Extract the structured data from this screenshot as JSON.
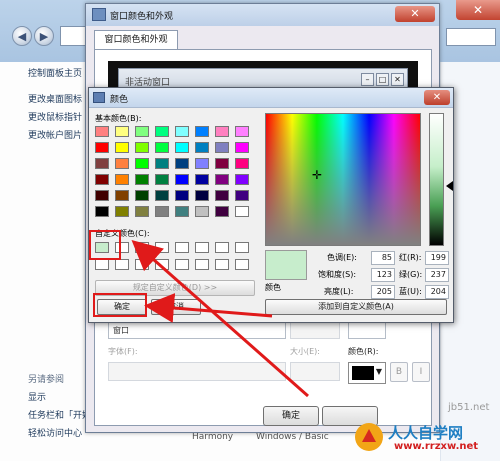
{
  "background_window": {
    "sidebar": {
      "links": [
        "控制面板主页",
        "更改桌面图标",
        "更改鼠标指针",
        "更改帐户图片"
      ],
      "see_also_title": "另请参阅",
      "see_also_links": [
        "显示",
        "任务栏和「开始」",
        "轻松访问中心"
      ]
    },
    "footer": [
      "Harmony",
      "Windows / Basic"
    ]
  },
  "window_color_dialog": {
    "title": "窗口颜色和外观",
    "tab": "窗口颜色和外观",
    "inactive_window_title": "非活动窗口",
    "item_value": "窗口",
    "font_label": "字体(F):",
    "size_label": "大小(E):",
    "color_label": "颜色(R):",
    "bold_label": "B",
    "italic_label": "I",
    "ok_button": "确定"
  },
  "color_picker": {
    "title": "颜色",
    "basic_colors_label": "基本颜色(B):",
    "basic_colors": [
      [
        "#ff8080",
        "#ffff80",
        "#80ff80",
        "#00ff80",
        "#80ffff",
        "#0080ff",
        "#ff80c0",
        "#ff80ff"
      ],
      [
        "#ff0000",
        "#ffff00",
        "#80ff00",
        "#00ff40",
        "#00ffff",
        "#0080c0",
        "#8080c0",
        "#ff00ff"
      ],
      [
        "#804040",
        "#ff8040",
        "#00ff00",
        "#008080",
        "#004080",
        "#8080ff",
        "#800040",
        "#ff0080"
      ],
      [
        "#800000",
        "#ff8000",
        "#008000",
        "#008040",
        "#0000ff",
        "#0000a0",
        "#800080",
        "#8000ff"
      ],
      [
        "#400000",
        "#804000",
        "#004000",
        "#004040",
        "#000080",
        "#000040",
        "#400040",
        "#400080"
      ],
      [
        "#000000",
        "#808000",
        "#808040",
        "#808080",
        "#408080",
        "#c0c0c0",
        "#400040",
        "#ffffff"
      ]
    ],
    "custom_colors_label": "自定义颜色(C):",
    "custom_colors": [
      "#c7edcc",
      "#ffffff",
      "#ffffff",
      "#ffffff",
      "#ffffff",
      "#ffffff",
      "#ffffff",
      "#ffffff",
      "#ffffff",
      "#ffffff",
      "#ffffff",
      "#ffffff",
      "#ffffff",
      "#ffffff",
      "#ffffff",
      "#ffffff"
    ],
    "define_custom_button": "规定自定义颜色(D) >>",
    "ok_button": "确定",
    "cancel_button": "取消",
    "color_solid_label": "颜色",
    "hue_label": "色调(E):",
    "hue_value": "85",
    "sat_label": "饱和度(S):",
    "sat_value": "123",
    "lum_label": "亮度(L):",
    "lum_value": "205",
    "red_label": "红(R):",
    "red_value": "199",
    "green_label": "绿(G):",
    "green_value": "237",
    "blue_label": "蓝(U):",
    "blue_value": "204",
    "add_custom_button": "添加到自定义颜色(A)",
    "selected_color": "#c7edcc"
  },
  "watermarks": {
    "site": "jb51.net",
    "brand": "人人自学网",
    "brand_url": "www.rrzxw.net"
  }
}
